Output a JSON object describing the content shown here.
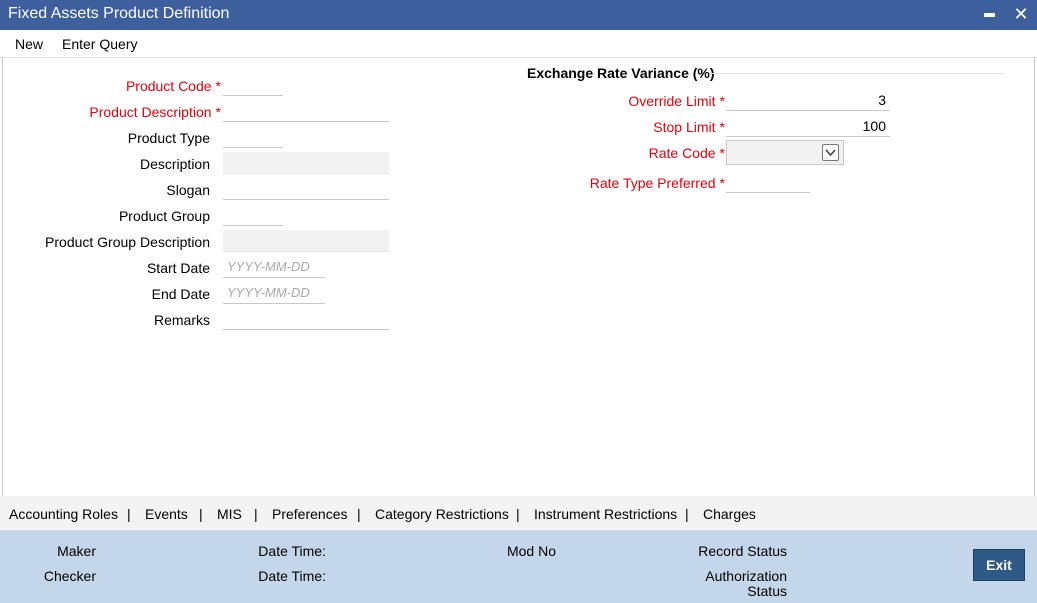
{
  "window": {
    "title": "Fixed Assets Product Definition"
  },
  "menu": {
    "new": "New",
    "enter_query": "Enter Query"
  },
  "left_form": {
    "product_code_label": "Product Code",
    "product_description_label": "Product Description",
    "product_type_label": "Product Type",
    "description_label": "Description",
    "slogan_label": "Slogan",
    "product_group_label": "Product Group",
    "product_group_description_label": "Product Group Description",
    "start_date_label": "Start Date",
    "start_date_placeholder": "YYYY-MM-DD",
    "end_date_label": "End Date",
    "end_date_placeholder": "YYYY-MM-DD",
    "remarks_label": "Remarks",
    "required_mark": "*"
  },
  "exchange_rate": {
    "section_title": "Exchange Rate Variance (%)",
    "override_limit_label": "Override Limit",
    "override_limit_value": "3",
    "stop_limit_label": "Stop Limit",
    "stop_limit_value": "100",
    "rate_code_label": "Rate Code",
    "rate_type_preferred_label": "Rate Type Preferred",
    "required_mark": "*"
  },
  "tabs": {
    "accounting_roles": "Accounting Roles",
    "events": "Events",
    "mis": "MIS",
    "preferences": "Preferences",
    "category_restrictions": "Category Restrictions",
    "instrument_restrictions": "Instrument Restrictions",
    "charges": "Charges",
    "separator": "|"
  },
  "footer": {
    "maker": "Maker",
    "checker": "Checker",
    "date_time_1": "Date Time:",
    "date_time_2": "Date Time:",
    "mod_no": "Mod No",
    "record_status": "Record Status",
    "authorization_status_line1": "Authorization",
    "authorization_status_line2": "Status",
    "exit": "Exit"
  },
  "icons": {
    "minimize": "minimize-icon",
    "close": "close-icon",
    "dropdown": "chevron-down-icon"
  },
  "colors": {
    "titlebar": "#3d5f9d",
    "required": "#e8000b",
    "footer": "#c4d7ea",
    "exit_button": "#2e5a85"
  }
}
